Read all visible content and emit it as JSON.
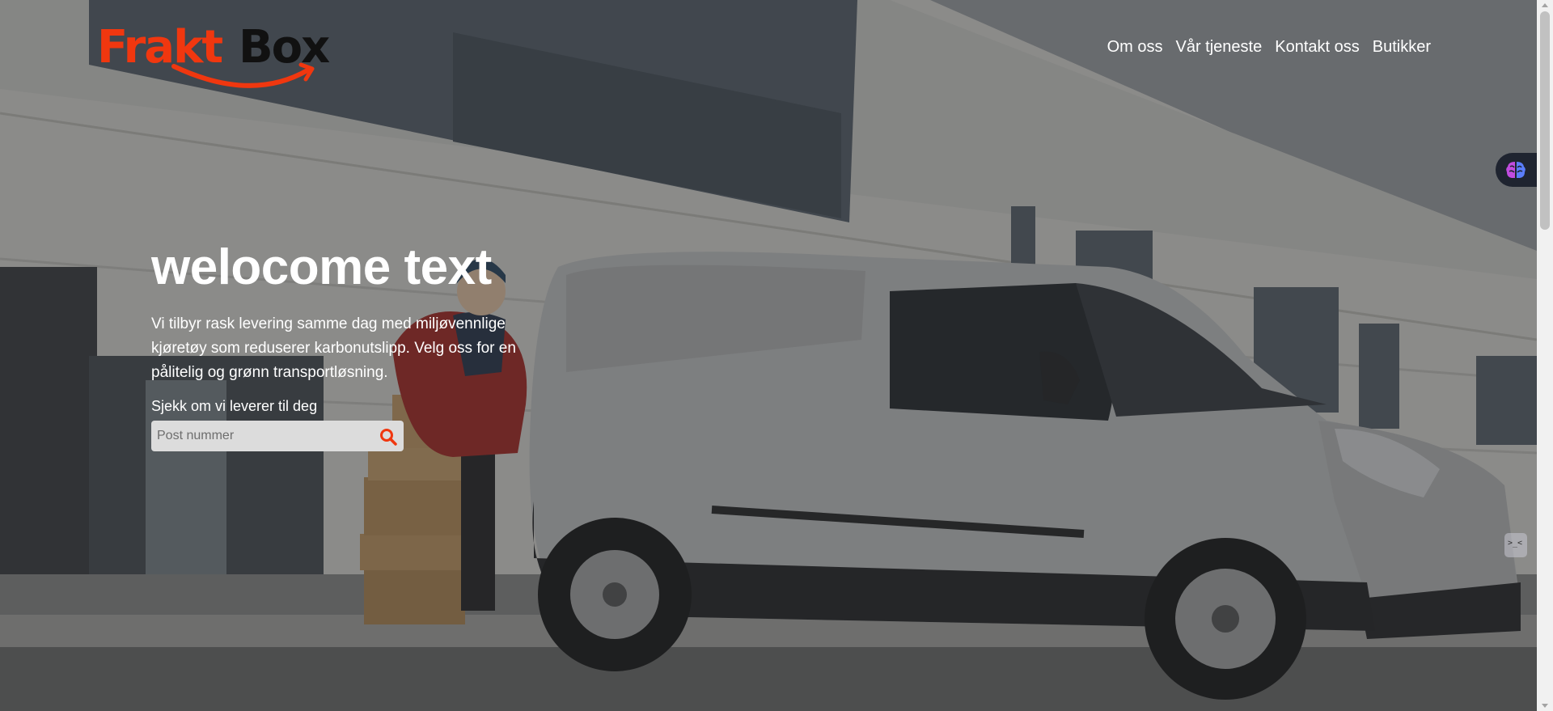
{
  "brand": {
    "logo_text_red": "Frakt",
    "logo_text_black": "Box",
    "colors": {
      "accent": "#f0370f",
      "logo_dark": "#111111"
    }
  },
  "nav": {
    "items": [
      {
        "label": "Om oss"
      },
      {
        "label": "Vår tjeneste"
      },
      {
        "label": "Kontakt oss"
      },
      {
        "label": "Butikker"
      }
    ]
  },
  "hero": {
    "title": "welocome text",
    "description": "Vi tilbyr rask levering samme dag med miljøvennlige kjøretøy som reduserer karbonutslipp. Velg oss for en pålitelig og grønn transportløsning.",
    "check_label": "Sjekk om vi leverer til deg",
    "search": {
      "placeholder": "Post nummer",
      "value": "",
      "button_icon": "search-icon"
    }
  },
  "widgets": {
    "ext_tab_icon": "brain-icon",
    "ext_small_icon": "code-face-icon",
    "ext_small_text": ">_<"
  }
}
